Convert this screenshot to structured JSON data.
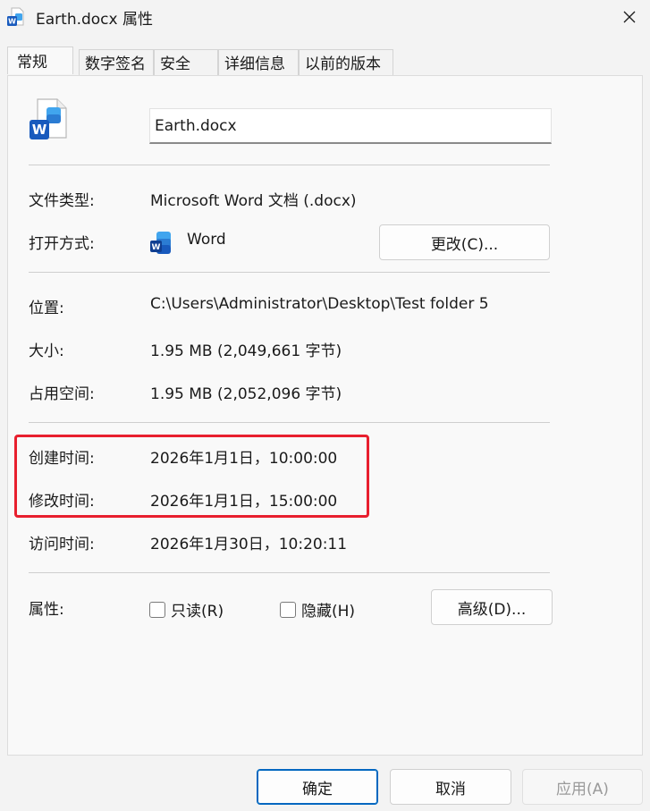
{
  "window": {
    "title": "Earth.docx 属性",
    "close_icon": "close-icon"
  },
  "tabs": [
    {
      "label": "常规",
      "active": true
    },
    {
      "label": "数字签名",
      "active": false
    },
    {
      "label": "安全",
      "active": false
    },
    {
      "label": "详细信息",
      "active": false
    },
    {
      "label": "以前的版本",
      "active": false
    }
  ],
  "general": {
    "file_name": "Earth.docx",
    "file_type_label": "文件类型:",
    "file_type_value": "Microsoft Word 文档 (.docx)",
    "open_with_label": "打开方式:",
    "open_with_value": "Word",
    "change_button": "更改(C)...",
    "location_label": "位置:",
    "location_value": "C:\\Users\\Administrator\\Desktop\\Test folder 5",
    "size_label": "大小:",
    "size_value": "1.95 MB (2,049,661 字节)",
    "size_on_disk_label": "占用空间:",
    "size_on_disk_value": "1.95 MB (2,052,096 字节)",
    "created_label": "创建时间:",
    "created_value": "2026年1月1日，10:00:00",
    "modified_label": "修改时间:",
    "modified_value": "2026年1月1日，15:00:00",
    "accessed_label": "访问时间:",
    "accessed_value": "2026年1月30日，10:20:11",
    "attributes_label": "属性:",
    "readonly_label": "只读(R)",
    "readonly_checked": false,
    "hidden_label": "隐藏(H)",
    "hidden_checked": false,
    "advanced_button": "高级(D)..."
  },
  "footer": {
    "ok_button": "确定",
    "cancel_button": "取消",
    "apply_button": "应用(A)"
  },
  "colors": {
    "highlight": "#e81f2e",
    "word_blue": "#185abd",
    "accent": "#0067c0"
  }
}
